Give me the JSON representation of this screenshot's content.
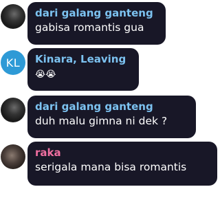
{
  "messages": [
    {
      "sender": "dari galang ganteng",
      "text": "gabisa romantis gua",
      "sender_color": "#7cc2f0",
      "avatar": "photo"
    },
    {
      "sender": "Kinara, Leaving",
      "text": "😭😭",
      "sender_color": "#7cc2f0",
      "avatar_initials": "KL",
      "avatar_color": "#2e9ad6"
    },
    {
      "sender": "dari galang ganteng",
      "text": "duh malu gimna ni dek ?",
      "sender_color": "#7cc2f0",
      "avatar": "photo"
    },
    {
      "sender": "raka",
      "text": "serigala mana bisa romantis",
      "sender_color": "#f06fa1",
      "avatar": "photo"
    }
  ]
}
